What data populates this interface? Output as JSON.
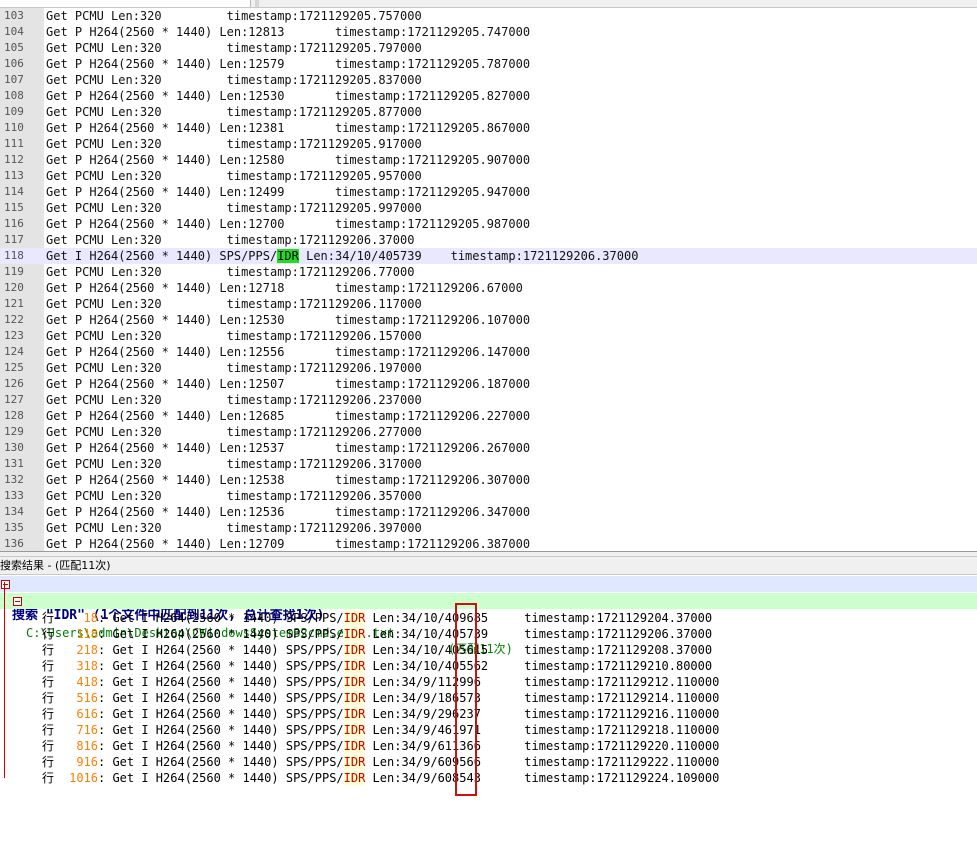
{
  "editor": {
    "lines": [
      {
        "num": "103",
        "pre": "Get PCMU Len:320         timestamp:1721129205.757000",
        "match": "",
        "post": ""
      },
      {
        "num": "104",
        "pre": "Get P H264(2560 * 1440) Len:12813       timestamp:1721129205.747000",
        "match": "",
        "post": ""
      },
      {
        "num": "105",
        "pre": "Get PCMU Len:320         timestamp:1721129205.797000",
        "match": "",
        "post": ""
      },
      {
        "num": "106",
        "pre": "Get P H264(2560 * 1440) Len:12579       timestamp:1721129205.787000",
        "match": "",
        "post": ""
      },
      {
        "num": "107",
        "pre": "Get PCMU Len:320         timestamp:1721129205.837000",
        "match": "",
        "post": ""
      },
      {
        "num": "108",
        "pre": "Get P H264(2560 * 1440) Len:12530       timestamp:1721129205.827000",
        "match": "",
        "post": ""
      },
      {
        "num": "109",
        "pre": "Get PCMU Len:320         timestamp:1721129205.877000",
        "match": "",
        "post": ""
      },
      {
        "num": "110",
        "pre": "Get P H264(2560 * 1440) Len:12381       timestamp:1721129205.867000",
        "match": "",
        "post": ""
      },
      {
        "num": "111",
        "pre": "Get PCMU Len:320         timestamp:1721129205.917000",
        "match": "",
        "post": ""
      },
      {
        "num": "112",
        "pre": "Get P H264(2560 * 1440) Len:12580       timestamp:1721129205.907000",
        "match": "",
        "post": ""
      },
      {
        "num": "113",
        "pre": "Get PCMU Len:320         timestamp:1721129205.957000",
        "match": "",
        "post": ""
      },
      {
        "num": "114",
        "pre": "Get P H264(2560 * 1440) Len:12499       timestamp:1721129205.947000",
        "match": "",
        "post": ""
      },
      {
        "num": "115",
        "pre": "Get PCMU Len:320         timestamp:1721129205.997000",
        "match": "",
        "post": ""
      },
      {
        "num": "116",
        "pre": "Get P H264(2560 * 1440) Len:12700       timestamp:1721129205.987000",
        "match": "",
        "post": ""
      },
      {
        "num": "117",
        "pre": "Get PCMU Len:320         timestamp:1721129206.37000",
        "match": "",
        "post": ""
      },
      {
        "num": "118",
        "pre": "Get I H264(2560 * 1440) SPS/PPS/",
        "match": "IDR",
        "post": " Len:34/10/405739    timestamp:1721129206.37000",
        "current": true
      },
      {
        "num": "119",
        "pre": "Get PCMU Len:320         timestamp:1721129206.77000",
        "match": "",
        "post": ""
      },
      {
        "num": "120",
        "pre": "Get P H264(2560 * 1440) Len:12718       timestamp:1721129206.67000",
        "match": "",
        "post": ""
      },
      {
        "num": "121",
        "pre": "Get PCMU Len:320         timestamp:1721129206.117000",
        "match": "",
        "post": ""
      },
      {
        "num": "122",
        "pre": "Get P H264(2560 * 1440) Len:12530       timestamp:1721129206.107000",
        "match": "",
        "post": ""
      },
      {
        "num": "123",
        "pre": "Get PCMU Len:320         timestamp:1721129206.157000",
        "match": "",
        "post": ""
      },
      {
        "num": "124",
        "pre": "Get P H264(2560 * 1440) Len:12556       timestamp:1721129206.147000",
        "match": "",
        "post": ""
      },
      {
        "num": "125",
        "pre": "Get PCMU Len:320         timestamp:1721129206.197000",
        "match": "",
        "post": ""
      },
      {
        "num": "126",
        "pre": "Get P H264(2560 * 1440) Len:12507       timestamp:1721129206.187000",
        "match": "",
        "post": ""
      },
      {
        "num": "127",
        "pre": "Get PCMU Len:320         timestamp:1721129206.237000",
        "match": "",
        "post": ""
      },
      {
        "num": "128",
        "pre": "Get P H264(2560 * 1440) Len:12685       timestamp:1721129206.227000",
        "match": "",
        "post": ""
      },
      {
        "num": "129",
        "pre": "Get PCMU Len:320         timestamp:1721129206.277000",
        "match": "",
        "post": ""
      },
      {
        "num": "130",
        "pre": "Get P H264(2560 * 1440) Len:12537       timestamp:1721129206.267000",
        "match": "",
        "post": ""
      },
      {
        "num": "131",
        "pre": "Get PCMU Len:320         timestamp:1721129206.317000",
        "match": "",
        "post": ""
      },
      {
        "num": "132",
        "pre": "Get P H264(2560 * 1440) Len:12538       timestamp:1721129206.307000",
        "match": "",
        "post": ""
      },
      {
        "num": "133",
        "pre": "Get PCMU Len:320         timestamp:1721129206.357000",
        "match": "",
        "post": ""
      },
      {
        "num": "134",
        "pre": "Get P H264(2560 * 1440) Len:12536       timestamp:1721129206.347000",
        "match": "",
        "post": ""
      },
      {
        "num": "135",
        "pre": "Get PCMU Len:320         timestamp:1721129206.397000",
        "match": "",
        "post": ""
      },
      {
        "num": "136",
        "pre": "Get P H264(2560 * 1440) Len:12709       timestamp:1721129206.387000",
        "match": "",
        "post": ""
      }
    ]
  },
  "results_panel": {
    "title": "搜索结果 - (匹配11次)",
    "search_header": "搜索 \"IDR\" (1个文件中匹配到11次, 总计查找1次)",
    "file_path": "C:\\Users\\admin\\Desktop\\CWindowsSystem32cmd.exe8.txt",
    "file_count": "(匹配11次)",
    "row_label": "行",
    "matches": [
      {
        "line": "18",
        "pre": ": Get I H264(2560 * 1440) SPS/PPS/",
        "match": "IDR",
        "post": " Len:34/10/409685     timestamp:1721129204.37000"
      },
      {
        "line": "118",
        "pre": ": Get I H264(2560 * 1440) SPS/PPS/",
        "match": "IDR",
        "post": " Len:34/10/405739     timestamp:1721129206.37000"
      },
      {
        "line": "218",
        "pre": ": Get I H264(2560 * 1440) SPS/PPS/",
        "match": "IDR",
        "post": " Len:34/10/405615     timestamp:1721129208.37000"
      },
      {
        "line": "318",
        "pre": ": Get I H264(2560 * 1440) SPS/PPS/",
        "match": "IDR",
        "post": " Len:34/10/405562     timestamp:1721129210.80000"
      },
      {
        "line": "418",
        "pre": ": Get I H264(2560 * 1440) SPS/PPS/",
        "match": "IDR",
        "post": " Len:34/9/112996      timestamp:1721129212.110000"
      },
      {
        "line": "516",
        "pre": ": Get I H264(2560 * 1440) SPS/PPS/",
        "match": "IDR",
        "post": " Len:34/9/186573      timestamp:1721129214.110000"
      },
      {
        "line": "616",
        "pre": ": Get I H264(2560 * 1440) SPS/PPS/",
        "match": "IDR",
        "post": " Len:34/9/296237      timestamp:1721129216.110000"
      },
      {
        "line": "716",
        "pre": ": Get I H264(2560 * 1440) SPS/PPS/",
        "match": "IDR",
        "post": " Len:34/9/461971      timestamp:1721129218.110000"
      },
      {
        "line": "816",
        "pre": ": Get I H264(2560 * 1440) SPS/PPS/",
        "match": "IDR",
        "post": " Len:34/9/611366      timestamp:1721129220.110000"
      },
      {
        "line": "916",
        "pre": ": Get I H264(2560 * 1440) SPS/PPS/",
        "match": "IDR",
        "post": " Len:34/9/609566      timestamp:1721129222.110000"
      },
      {
        "line": "1016",
        "pre": ": Get I H264(2560 * 1440) SPS/PPS/",
        "match": "IDR",
        "post": " Len:34/9/608543      timestamp:1721129224.109000"
      }
    ]
  },
  "colors": {
    "current_line": "#e8e8ff",
    "editor_match": "#22dd22",
    "result_match_text": "#cc0000",
    "result_line_number": "#ff8000",
    "search_header_text": "#000080",
    "file_row_bg": "#ccffcc",
    "annotation_box": "#cc1111"
  }
}
